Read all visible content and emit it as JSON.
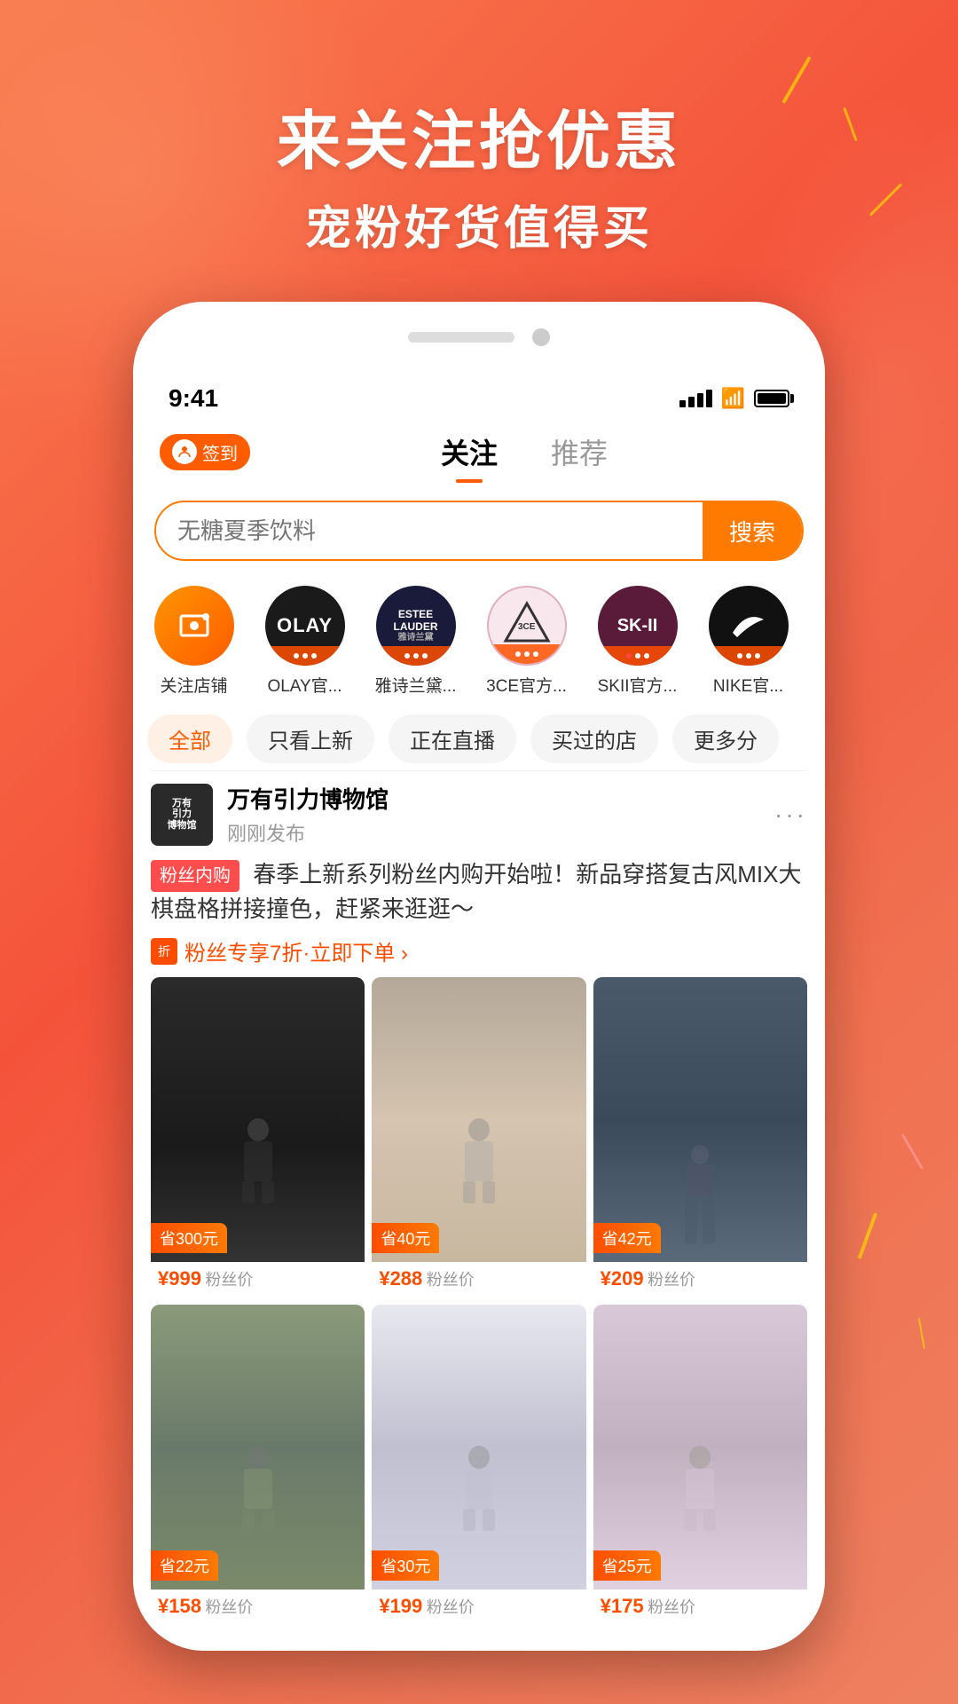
{
  "background": {
    "headline_main": "来关注抢优惠",
    "headline_sub": "宠粉好货值得买"
  },
  "status_bar": {
    "time": "9:41"
  },
  "header": {
    "checkin_label": "签到",
    "tabs": [
      {
        "label": "关注",
        "active": true
      },
      {
        "label": "推荐",
        "active": false
      }
    ]
  },
  "search": {
    "placeholder": "无糖夏季饮料",
    "button_label": "搜索"
  },
  "stores": [
    {
      "name": "关注店铺",
      "type": "follow",
      "bg": "#ff7a00"
    },
    {
      "name": "OLAY官...",
      "type": "olay",
      "bg": "#000000"
    },
    {
      "name": "雅诗兰黛...",
      "type": "estee",
      "bg": "#1a1a3a"
    },
    {
      "name": "3CE官方...",
      "type": "3ce",
      "bg": "#f0d0d8"
    },
    {
      "name": "SKII官方...",
      "type": "skii",
      "bg": "#5a1a3a"
    },
    {
      "name": "NIKE官...",
      "type": "nike",
      "bg": "#111111"
    }
  ],
  "filters": [
    {
      "label": "全部",
      "active": true
    },
    {
      "label": "只看上新",
      "active": false
    },
    {
      "label": "正在直播",
      "active": false
    },
    {
      "label": "买过的店",
      "active": false
    },
    {
      "label": "更多分",
      "active": false
    }
  ],
  "post": {
    "store_name": "万有引力博物馆",
    "time": "刚刚发布",
    "tag": "粉丝内购",
    "content": "春季上新系列粉丝内购开始啦！新品穿搭复古风MIX大棋盘格拼接撞色，赶紧来逛逛～",
    "promo": "粉丝专享7折·立即下单 ›",
    "products": [
      {
        "save": "省300元",
        "price": "¥999",
        "label": "粉丝价",
        "img_class": "img-black-outfit"
      },
      {
        "save": "省40元",
        "price": "¥288",
        "label": "粉丝价",
        "img_class": "img-beige-outfit"
      },
      {
        "save": "省42元",
        "price": "¥209",
        "label": "粉丝价",
        "img_class": "img-dark-pants"
      },
      {
        "save": "省22元",
        "price": "¥158",
        "label": "粉丝价",
        "img_class": "img-casual-outfit"
      },
      {
        "save": "省30元",
        "price": "¥199",
        "label": "粉丝价",
        "img_class": "img-stripe-outfit"
      },
      {
        "save": "省25元",
        "price": "¥175",
        "label": "粉丝价",
        "img_class": "img-light-outfit"
      }
    ]
  },
  "colors": {
    "orange": "#ff5c00",
    "orange_light": "#ff7a00",
    "red": "#ff4d4d"
  }
}
